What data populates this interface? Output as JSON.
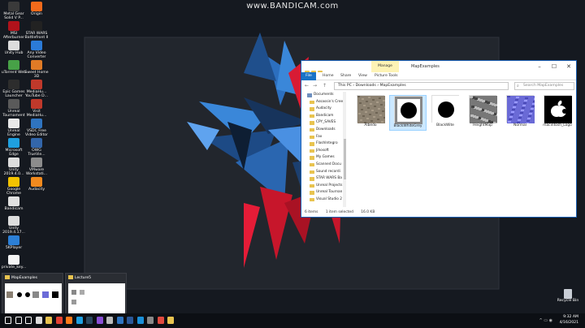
{
  "watermark": "www.BANDICAM.com",
  "desktop_icons": [
    {
      "label": "Metal Gear\nSolid V P...",
      "color": "#3a3a3a"
    },
    {
      "label": "Origin",
      "color": "#f26a1b"
    },
    {
      "label": "MSI\nAfterburner",
      "color": "#b0121b"
    },
    {
      "label": "STAR WARS\nBattlefront II",
      "color": "#222222"
    },
    {
      "label": "Unity Hub",
      "color": "#dddddd"
    },
    {
      "label": "Any Video\nConverter",
      "color": "#2b7bd8"
    },
    {
      "label": "uTorrent Web",
      "color": "#47a147"
    },
    {
      "label": "Sweet Home\n3D",
      "color": "#e07b26"
    },
    {
      "label": "Epic Games\nLauncher",
      "color": "#2d2d2d"
    },
    {
      "label": "MediaHu...\nYouTube D...",
      "color": "#c0392b"
    },
    {
      "label": "Unreal\nTournament",
      "color": "#5a5a5a"
    },
    {
      "label": "Visit\nMediaHu...",
      "color": "#c0392b"
    },
    {
      "label": "Unreal\nEngine",
      "color": "#e9e9e9"
    },
    {
      "label": "VSDC Free\nVideo Editor",
      "color": "#2f74c0"
    },
    {
      "label": "Microsoft\nEdge",
      "color": "#1fa0e0"
    },
    {
      "label": "OWG\nTrueVie...",
      "color": "#3366aa"
    },
    {
      "label": "Unity\n2019.4.0...",
      "color": "#dddddd"
    },
    {
      "label": "VMware\nWorkstati...",
      "color": "#8c8c8c"
    },
    {
      "label": "Google\nChrome",
      "color": "#f2c200"
    },
    {
      "label": "Audacity",
      "color": "#f28a1e"
    },
    {
      "label": "Bandicam",
      "color": "#e0e0e0"
    },
    {
      "label": "Unity\n2019.4.17...",
      "color": "#dddddd"
    },
    {
      "label": "5KPlayer",
      "color": "#2c7fd6"
    },
    {
      "label": "private_key...",
      "color": "#f5f5f5"
    }
  ],
  "explorer": {
    "title": "MapExamples",
    "manage_label": "Manage",
    "tabs": [
      "File",
      "Home",
      "Share",
      "View",
      "Picture Tools"
    ],
    "nav_back": "←",
    "nav_forward": "→",
    "nav_up": "↑",
    "breadcrumb": [
      "This PC",
      "Downloads",
      "MapExamples"
    ],
    "search_placeholder": "Search MapExamples",
    "nav_items": [
      "Documents",
      "Assassin's Cree",
      "Audacity",
      "Bandicam",
      "CPY_SAVES",
      "Downloads",
      "Fax",
      "FlashIntegro",
      "Jihosoft",
      "My Games",
      "Scanned Docu",
      "Sound recordi",
      "STAR WARS Ba",
      "Unreal Projects",
      "Unreal Tournan",
      "Visual Studio 2"
    ],
    "files": [
      {
        "name": "Albedo",
        "kind": "stone"
      },
      {
        "name": "BlackWhiteGrey",
        "kind": "bwg"
      },
      {
        "name": "BlackWite",
        "kind": "bw"
      },
      {
        "name": "HeightMap",
        "kind": "height"
      },
      {
        "name": "Normal",
        "kind": "normal"
      },
      {
        "name": "macintosh_Logo",
        "kind": "apple"
      }
    ],
    "status": {
      "count": "6 items",
      "selected": "1 item selected",
      "size": "16.0 KB"
    }
  },
  "previews": [
    {
      "title": "MapExamples"
    },
    {
      "title": "Lecture5"
    }
  ],
  "recycle_bin": "Recycle Bin",
  "clock": {
    "time": "9:32 AM",
    "date": "4/16/2021"
  },
  "taskbar_icons": [
    {
      "name": "start-icon",
      "color": "#ffffff"
    },
    {
      "name": "search-icon",
      "color": "#ffffff"
    },
    {
      "name": "task-view-icon",
      "color": "#ffffff"
    },
    {
      "name": "unity-icon",
      "color": "#dddddd"
    },
    {
      "name": "explorer-icon",
      "color": "#e8c34f"
    },
    {
      "name": "chrome-icon",
      "color": "#e34133"
    },
    {
      "name": "firefox-icon",
      "color": "#ff7b1a"
    },
    {
      "name": "edge-icon",
      "color": "#1fa0e0"
    },
    {
      "name": "steam-icon",
      "color": "#2a475e"
    },
    {
      "name": "media-icon",
      "color": "#8a4fd6"
    },
    {
      "name": "unreal-icon",
      "color": "#bbbbbb"
    },
    {
      "name": "vscode-icon",
      "color": "#2f74c0"
    },
    {
      "name": "word-icon",
      "color": "#2b5797"
    },
    {
      "name": "photos-icon",
      "color": "#1a8fd8"
    },
    {
      "name": "settings-icon",
      "color": "#888888"
    },
    {
      "name": "bandicam-icon",
      "color": "#e04a3f"
    },
    {
      "name": "folder-icon",
      "color": "#e8c34f"
    }
  ]
}
